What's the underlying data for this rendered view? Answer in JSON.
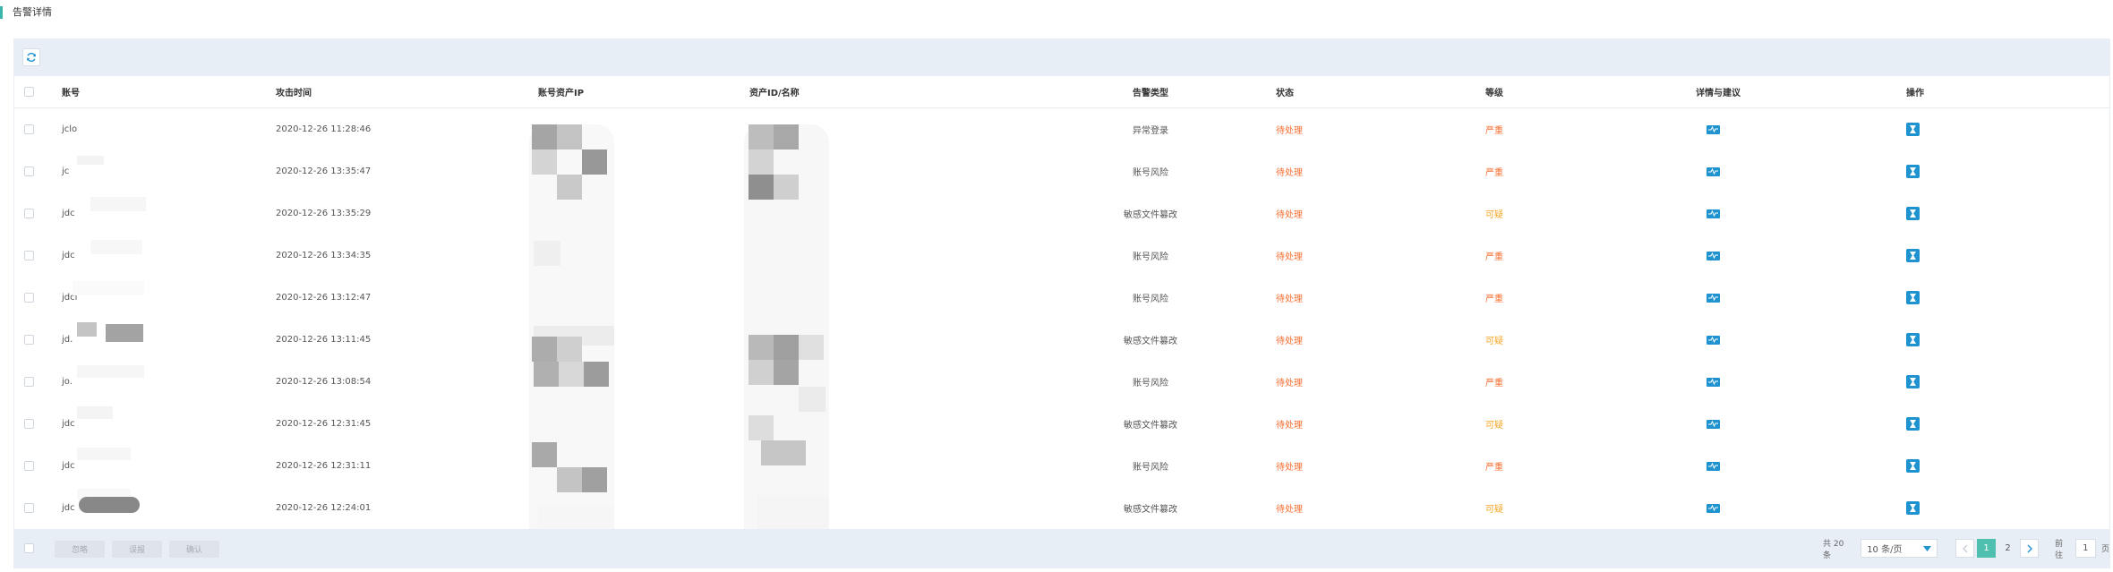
{
  "page": {
    "title": "告警详情"
  },
  "table": {
    "columns": {
      "account": "账号",
      "attack_time": "攻击时间",
      "asset_ip": "账号资产IP",
      "asset_name": "资产ID/名称",
      "alert_type": "告警类型",
      "status": "状态",
      "level": "等级",
      "detail": "详情与建议",
      "ops": "操作"
    },
    "rows": [
      {
        "account": "jclo",
        "time": "2020-12-26 11:28:46",
        "alert_type": "异常登录",
        "status": "待处理",
        "level": "严重"
      },
      {
        "account": "jc",
        "time": "2020-12-26 13:35:47",
        "alert_type": "账号风险",
        "status": "待处理",
        "level": "严重"
      },
      {
        "account": "jdc",
        "time": "2020-12-26 13:35:29",
        "alert_type": "敏感文件篡改",
        "status": "待处理",
        "level": "可疑"
      },
      {
        "account": "jdc",
        "time": "2020-12-26 13:34:35",
        "alert_type": "账号风险",
        "status": "待处理",
        "level": "严重"
      },
      {
        "account": "jdcl",
        "time": "2020-12-26 13:12:47",
        "alert_type": "账号风险",
        "status": "待处理",
        "level": "严重"
      },
      {
        "account": "jd.",
        "time": "2020-12-26 13:11:45",
        "alert_type": "敏感文件篡改",
        "status": "待处理",
        "level": "可疑"
      },
      {
        "account": "jo.",
        "time": "2020-12-26 13:08:54",
        "alert_type": "账号风险",
        "status": "待处理",
        "level": "严重"
      },
      {
        "account": "jdc",
        "time": "2020-12-26 12:31:45",
        "alert_type": "敏感文件篡改",
        "status": "待处理",
        "level": "可疑"
      },
      {
        "account": "jdc",
        "time": "2020-12-26 12:31:11",
        "alert_type": "账号风险",
        "status": "待处理",
        "level": "严重"
      },
      {
        "account": "jdc",
        "time": "2020-12-26 12:24:01",
        "alert_type": "敏感文件篡改",
        "status": "待处理",
        "level": "可疑"
      }
    ]
  },
  "footer": {
    "ignore_label": "忽略",
    "misreport_label": "误报",
    "confirm_label": "确认",
    "total": "共 20 条",
    "page_size": "10 条/页",
    "pages": [
      "1",
      "2"
    ],
    "goto_label": "前往",
    "goto_value": "1",
    "page_suffix": "页"
  },
  "colors": {
    "accent": "#4fc0b0",
    "icon_blue": "#1f93d0",
    "severe": "#f56c2d",
    "suspect": "#f5a623",
    "toolbar_bg": "#e7eef6"
  },
  "icons": {
    "refresh": "refresh-icon",
    "detail": "activity-icon",
    "operate": "hourglass-icon",
    "select": "chevron-down-icon",
    "prev": "chevron-left-icon",
    "next": "chevron-right-icon"
  }
}
